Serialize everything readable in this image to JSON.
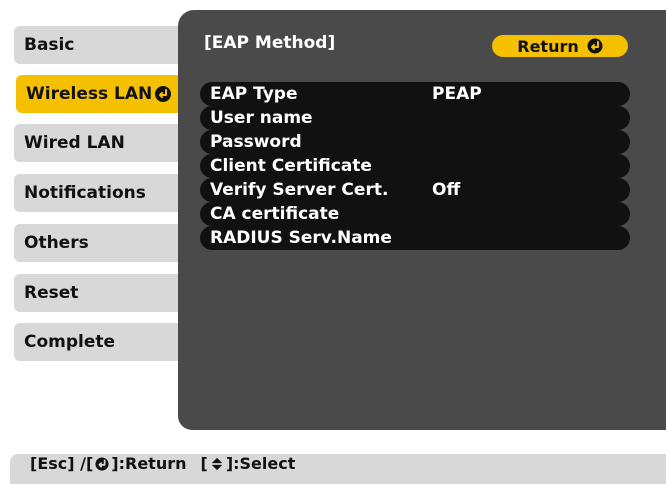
{
  "sidebar": {
    "items": [
      {
        "label": "Basic"
      },
      {
        "label": "Wireless LAN"
      },
      {
        "label": "Wired LAN"
      },
      {
        "label": "Notifications"
      },
      {
        "label": "Others"
      },
      {
        "label": "Reset"
      },
      {
        "label": "Complete"
      }
    ]
  },
  "panel": {
    "title": "[EAP Method]",
    "return_label": "Return"
  },
  "menu": {
    "rows": [
      {
        "label": "EAP Type",
        "value": "PEAP"
      },
      {
        "label": "User name",
        "value": ""
      },
      {
        "label": "Password",
        "value": ""
      },
      {
        "label": "Client Certificate",
        "value": ""
      },
      {
        "label": "Verify Server Cert.",
        "value": "Off"
      },
      {
        "label": "CA certificate",
        "value": ""
      },
      {
        "label": "RADIUS Serv.Name",
        "value": ""
      }
    ]
  },
  "footer": {
    "esc_text": "[Esc] /[",
    "return_text": "]:Return",
    "select_open": "[",
    "select_text": "]:Select"
  },
  "colors": {
    "accent": "#f5c000",
    "panel": "#4a4a4a",
    "tab": "#d8d8d8"
  }
}
